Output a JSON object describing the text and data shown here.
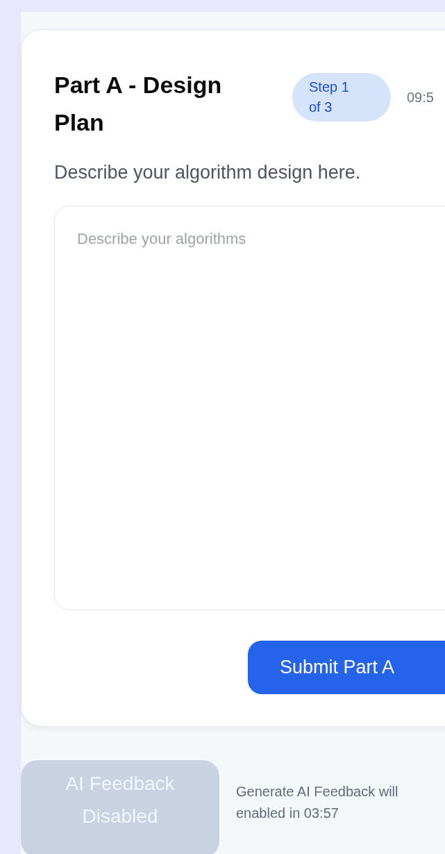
{
  "header": {
    "title": "Part A - Design Plan",
    "step_badge": "Step 1 of 3",
    "timer": "09:5"
  },
  "prompt": "Describe your algorithm design here.",
  "answer": {
    "placeholder": "Describe your algorithms"
  },
  "submit_button": {
    "label": "Submit Part A",
    "disabled": false
  },
  "feedback_button": {
    "label": "AI Feedback Disabled",
    "disabled": true
  },
  "feedback_note": [
    "Generate AI Feedback will",
    "enabled in 03:57"
  ]
}
